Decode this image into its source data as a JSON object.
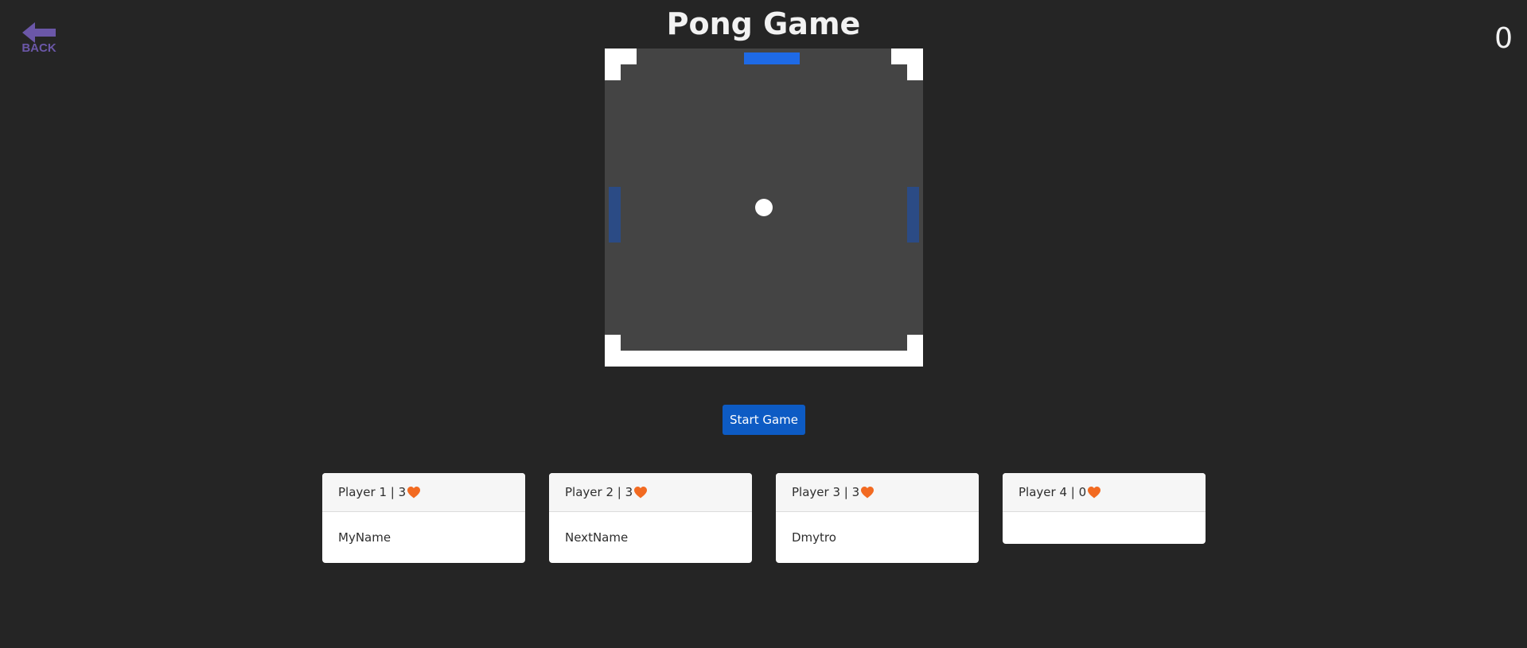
{
  "header": {
    "back_label": "BACK",
    "title": "Pong Game",
    "score": "0"
  },
  "game": {
    "start_label": "Start Game"
  },
  "players": [
    {
      "label": "Player 1",
      "lives": "3",
      "name": "MyName"
    },
    {
      "label": "Player 2",
      "lives": "3",
      "name": "NextName"
    },
    {
      "label": "Player 3",
      "lives": "3",
      "name": "Dmytro"
    },
    {
      "label": "Player 4",
      "lives": "0",
      "name": ""
    }
  ],
  "colors": {
    "background": "#252525",
    "board": "#444444",
    "paddle_active": "#1e6ae6",
    "paddle_side": "#2b4b85",
    "start_button": "#0d5bc4",
    "back_icon": "#6b57a8",
    "heart": "#f26a21"
  },
  "icons": {
    "back": "arrow-left-icon",
    "heart": "heart-icon"
  }
}
